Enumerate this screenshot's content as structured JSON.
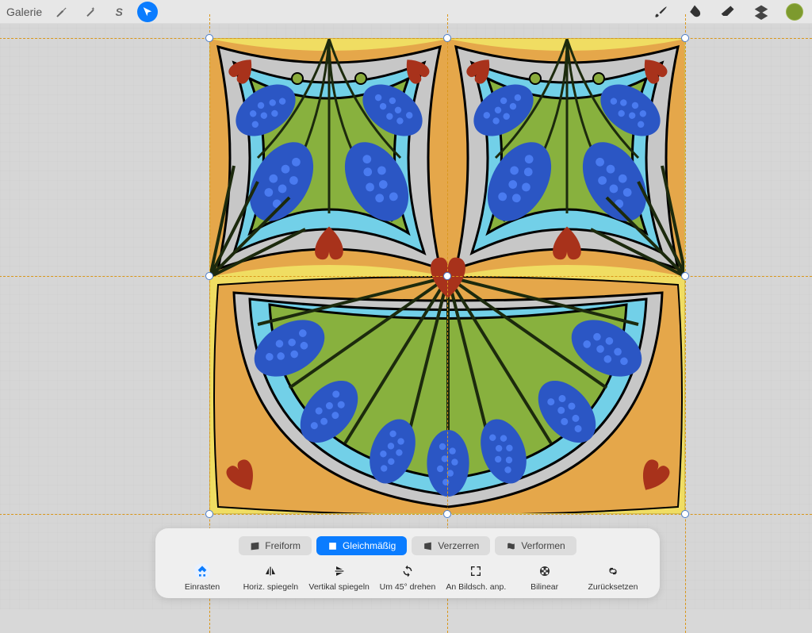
{
  "topbar": {
    "gallery": "Galerie",
    "color": "#7d9a2e"
  },
  "transform": {
    "modes": {
      "freeform": "Freiform",
      "uniform": "Gleichmäßig",
      "distort": "Verzerren",
      "warp": "Verformen"
    },
    "actions": {
      "snap": "Einrasten",
      "fliph": "Horiz. spiegeln",
      "flipv": "Vertikal spiegeln",
      "rotate45": "Um 45° drehen",
      "fit": "An Bildsch. anp.",
      "interp": "Bilinear",
      "reset": "Zurücksetzen"
    }
  }
}
